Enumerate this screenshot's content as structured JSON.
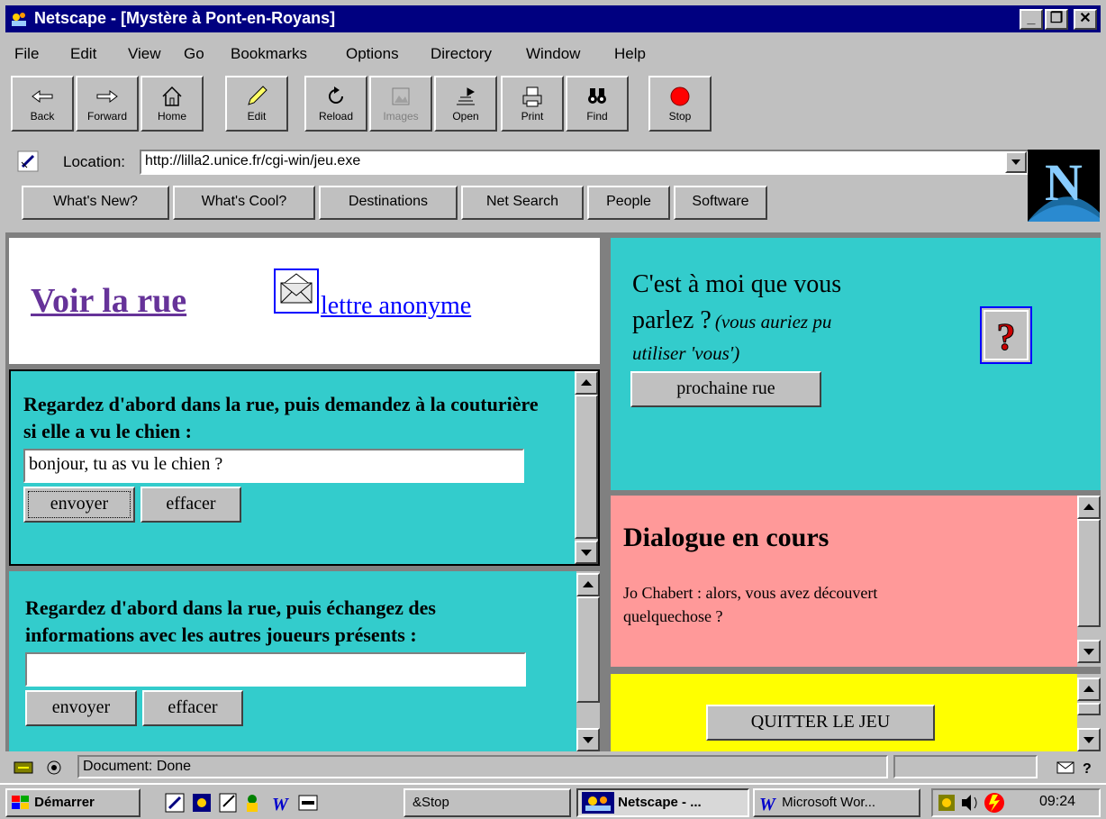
{
  "window": {
    "title": "Netscape - [Mystère à Pont-en-Royans]",
    "controls": {
      "minimize": "_",
      "restore": "❐",
      "close": "✕"
    }
  },
  "menu": [
    "File",
    "Edit",
    "View",
    "Go",
    "Bookmarks",
    "Options",
    "Directory",
    "Window",
    "Help"
  ],
  "toolbar": {
    "back": "Back",
    "forward": "Forward",
    "home": "Home",
    "edit": "Edit",
    "reload": "Reload",
    "images": "Images",
    "open": "Open",
    "print": "Print",
    "find": "Find",
    "stop": "Stop"
  },
  "location": {
    "label": "Location:",
    "url": "http://lilla2.unice.fr/cgi-win/jeu.exe"
  },
  "directory_buttons": [
    "What's New?",
    "What's Cool?",
    "Destinations",
    "Net Search",
    "People",
    "Software"
  ],
  "top_left_frame": {
    "link_main": "Voir la rue",
    "link_letter": "lettre anonyme"
  },
  "form1": {
    "instructions": "Regardez d'abord dans la rue, puis demandez à la couturière si elle a vu le chien :",
    "input_value": "bonjour, tu as vu le chien ?",
    "send": "envoyer",
    "clear": "effacer"
  },
  "form2": {
    "instructions": "Regardez d'abord dans la rue, puis échangez des informations avec les autres joueurs présents :",
    "input_value": "",
    "send": "envoyer",
    "clear": "effacer"
  },
  "right_top_frame": {
    "heading": "C'est à moi que vous parlez ?",
    "heading_line1": "C'est à moi que vous",
    "heading_line2": "parlez ?",
    "note_line1": "(vous auriez pu",
    "note_line2": "utiliser 'vous')",
    "next_street": "prochaine rue",
    "help_icon": "question-mark"
  },
  "dialogue": {
    "heading": "Dialogue en cours",
    "line1": "Jo Chabert : alors, vous avez découvert",
    "line2": "quelquechose ?"
  },
  "quit_frame": {
    "button": "QUITTER LE JEU",
    "bg": "#ffff00"
  },
  "status": {
    "text": "Document: Done"
  },
  "taskbar": {
    "start": "Démarrer",
    "stop_task": "&Stop",
    "netscape_task": "Netscape - ...",
    "word_task": "Microsoft Wor...",
    "clock": "09:24"
  },
  "colors": {
    "teal": "#33cccc",
    "pink": "#ff9999",
    "yellow": "#ffff00",
    "link": "#0000ff",
    "visited": "#663399",
    "titlebar": "#000080"
  }
}
